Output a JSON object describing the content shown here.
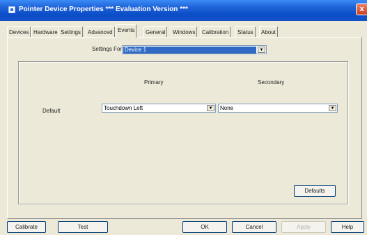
{
  "window": {
    "title": "Pointer Device Properties *** Evaluation Version ***",
    "close_label": "x"
  },
  "tabs": [
    {
      "label": "Devices",
      "active": false
    },
    {
      "label": "Hardware",
      "active": false
    },
    {
      "label": "Settings",
      "active": false
    },
    {
      "label": "Advanced",
      "active": false
    },
    {
      "label": "Events",
      "active": true
    },
    {
      "label": "General",
      "active": false
    },
    {
      "label": "Windows",
      "active": false
    },
    {
      "label": "Calibration",
      "active": false
    },
    {
      "label": "Status",
      "active": false
    },
    {
      "label": "About",
      "active": false
    }
  ],
  "settings_for": {
    "label": "Settings For:",
    "value": "Device 1"
  },
  "events": {
    "primary_header": "Primary",
    "secondary_header": "Secondary",
    "rows": [
      {
        "label": "Default",
        "primary": "Touchdown Left",
        "secondary": "None"
      }
    ]
  },
  "buttons": {
    "defaults": "Defaults",
    "calibrate": "Calibrate",
    "test": "Test",
    "ok": "OK",
    "cancel": "Cancel",
    "apply": "Apply",
    "help": "Help"
  },
  "colors": {
    "titlebar": "#0a4dc8",
    "face": "#ece9d8",
    "selection": "#316ac5"
  }
}
